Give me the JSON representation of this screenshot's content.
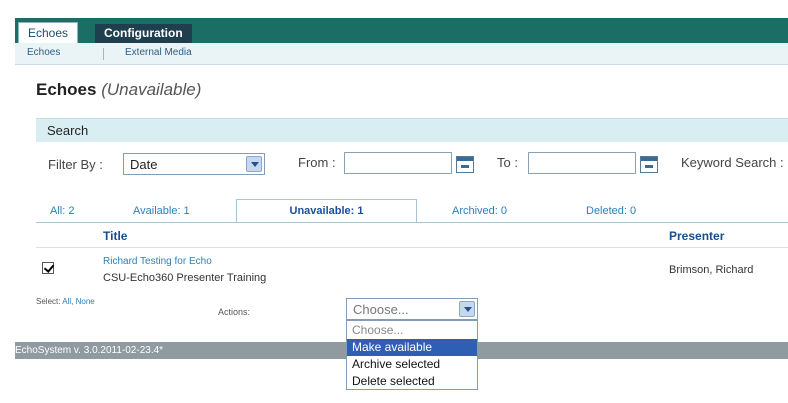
{
  "main_tabs": [
    {
      "label": "Echoes",
      "active": true
    },
    {
      "label": "Configuration",
      "active": false
    }
  ],
  "subnav": [
    "Echoes",
    "External Media"
  ],
  "page": {
    "title": "Echoes",
    "status": "(Unavailable)"
  },
  "search": {
    "header": "Search",
    "filter_label": "Filter By :",
    "filter_value": "Date",
    "from_label": "From :",
    "from_value": "",
    "to_label": "To :",
    "to_value": "",
    "keyword_label": "Keyword Search :"
  },
  "filter_tabs": [
    {
      "label": "All: 2"
    },
    {
      "label": "Available: 1"
    },
    {
      "label": "Unavailable: 1",
      "active": true
    },
    {
      "label": "Archived: 0"
    },
    {
      "label": "Deleted: 0"
    }
  ],
  "columns": {
    "title": "Title",
    "presenter": "Presenter"
  },
  "rows": [
    {
      "checked": true,
      "title": "Richard Testing for Echo",
      "subtitle": "CSU-Echo360 Presenter Training",
      "presenter": "Brimson, Richard"
    }
  ],
  "select": {
    "prefix": "Select:",
    "all": "All",
    "sep": ",",
    "none": "None"
  },
  "actions": {
    "label": "Actions:",
    "selected": "Choose...",
    "options": [
      "Choose...",
      "Make available",
      "Archive selected",
      "Delete selected"
    ],
    "highlighted": "Make available"
  },
  "footer": "EchoSystem v. 3.0.2011-02-23.4*",
  "colors": {
    "brand": "#1a6e64",
    "link": "#2d7fb8",
    "highlight": "#2f5fb2"
  }
}
